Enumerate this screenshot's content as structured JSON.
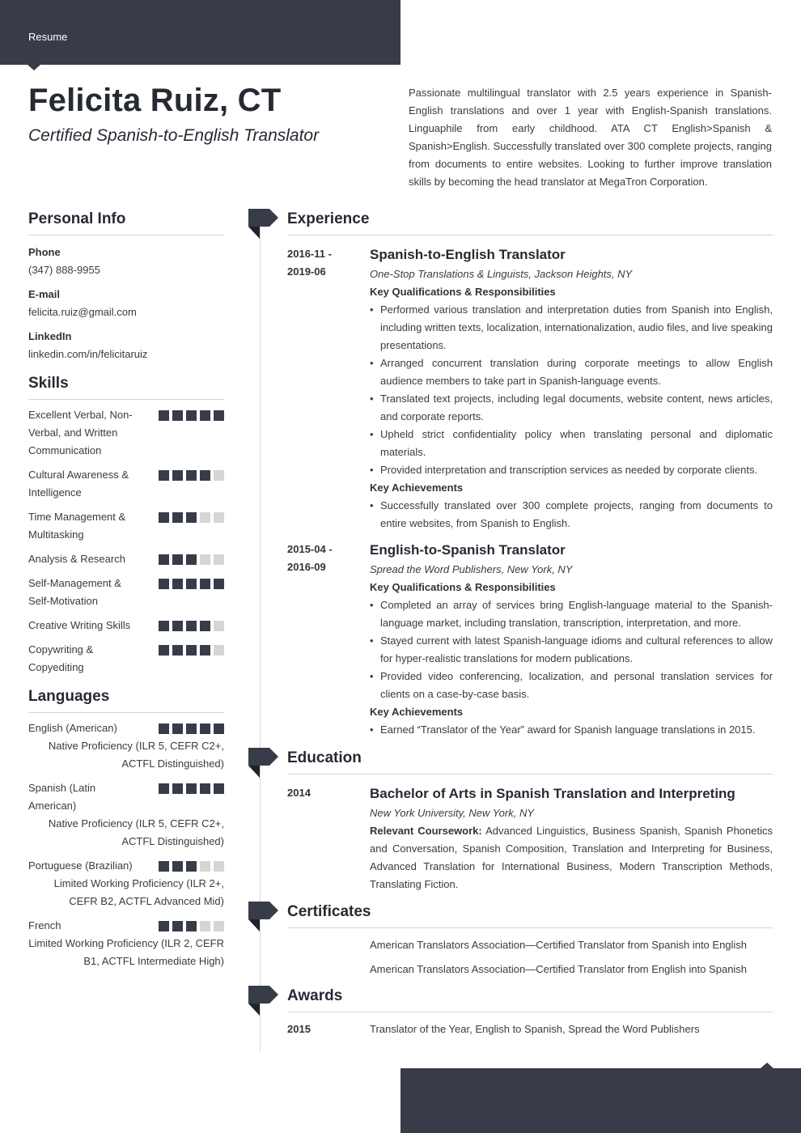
{
  "header": {
    "label": "Resume",
    "name": "Felicita Ruiz, CT",
    "title": "Certified Spanish-to-English Translator",
    "summary": "Passionate multilingual translator with 2.5 years experience in Spanish-English translations and over 1 year with English-Spanish translations. Linguaphile from early childhood. ATA CT English>Spanish & Spanish>English. Successfully translated over 300 complete projects, ranging from documents to entire websites. Looking to further improve translation skills by becoming the head translator at MegaTron Corporation."
  },
  "personal_info": {
    "heading": "Personal Info",
    "items": [
      {
        "label": "Phone",
        "value": "(347) 888-9955"
      },
      {
        "label": "E-mail",
        "value": "felicita.ruiz@gmail.com"
      },
      {
        "label": "LinkedIn",
        "value": "linkedin.com/in/felicitaruiz"
      }
    ]
  },
  "skills": {
    "heading": "Skills",
    "max_level": 5,
    "items": [
      {
        "name": "Excellent Verbal, Non-Verbal, and Written Communication",
        "level": 5
      },
      {
        "name": "Cultural Awareness & Intelligence",
        "level": 4
      },
      {
        "name": "Time Management & Multitasking",
        "level": 3
      },
      {
        "name": "Analysis & Research",
        "level": 3
      },
      {
        "name": "Self-Management & Self-Motivation",
        "level": 5
      },
      {
        "name": "Creative Writing Skills",
        "level": 4
      },
      {
        "name": "Copywriting & Copyediting",
        "level": 4
      }
    ]
  },
  "languages": {
    "heading": "Languages",
    "max_level": 5,
    "items": [
      {
        "name": "English (American)",
        "level": 5,
        "proficiency": "Native Proficiency (ILR 5, CEFR C2+, ACTFL Distinguished)"
      },
      {
        "name": "Spanish (Latin American)",
        "level": 5,
        "proficiency": "Native Proficiency (ILR 5, CEFR C2+, ACTFL Distinguished)"
      },
      {
        "name": "Portuguese (Brazilian)",
        "level": 3,
        "proficiency": "Limited Working Proficiency (ILR 2+, CEFR B2, ACTFL Advanced Mid)"
      },
      {
        "name": "French",
        "level": 3,
        "proficiency": "Limited Working Proficiency (ILR 2, CEFR B1, ACTFL Intermediate High)"
      }
    ]
  },
  "experience": {
    "heading": "Experience",
    "jobs": [
      {
        "date_start": "2016-11 -",
        "date_end": "2019-06",
        "title": "Spanish-to-English Translator",
        "company": "One-Stop Translations & Linguists, Jackson Heights, NY",
        "resp_heading": "Key Qualifications & Responsibilities",
        "responsibilities": [
          "Performed various translation and interpretation duties from Spanish into English, including written texts, localization, internationalization, audio files, and live speaking presentations.",
          "Arranged concurrent translation during corporate meetings to allow English audience members to take part in Spanish-language events.",
          "Translated text projects, including legal documents, website content, news articles, and corporate reports.",
          "Upheld strict confidentiality policy when translating personal and diplomatic materials.",
          "Provided interpretation and transcription services as needed by corporate clients."
        ],
        "ach_heading": "Key Achievements",
        "achievements": [
          "Successfully translated over 300 complete projects, ranging from documents to entire websites, from Spanish to English."
        ]
      },
      {
        "date_start": "2015-04 -",
        "date_end": "2016-09",
        "title": "English-to-Spanish Translator",
        "company": "Spread the Word Publishers, New York, NY",
        "resp_heading": "Key Qualifications & Responsibilities",
        "responsibilities": [
          "Completed an array of services bring English-language material to the Spanish-language market, including translation, transcription, interpretation, and more.",
          "Stayed current with latest Spanish-language idioms and cultural references to allow for hyper-realistic translations for modern publications.",
          "Provided video conferencing, localization, and personal translation services for clients on a case-by-case basis."
        ],
        "ach_heading": "Key Achievements",
        "achievements": [
          "Earned “Translator of the Year” award for Spanish language translations in 2015."
        ]
      }
    ]
  },
  "education": {
    "heading": "Education",
    "date": "2014",
    "degree": "Bachelor of Arts in Spanish Translation and Interpreting",
    "school": "New York University, New York, NY",
    "coursework_label": "Relevant Coursework:",
    "coursework": " Advanced Linguistics, Business Spanish, Spanish Phonetics and Conversation, Spanish Composition, Translation and Interpreting for Business, Advanced Translation for International Business, Modern Transcription Methods, Translating Fiction."
  },
  "certificates": {
    "heading": "Certificates",
    "items": [
      "American Translators Association—Certified Translator from Spanish into English",
      "American Translators Association—Certified Translator from English into Spanish"
    ]
  },
  "awards": {
    "heading": "Awards",
    "items": [
      {
        "date": "2015",
        "text": "Translator of the Year, English to Spanish, Spread the Word Publishers"
      }
    ]
  },
  "colors": {
    "accent": "#373c48",
    "accent_dark": "#1f232c",
    "dot_off": "#d5d5d5",
    "divider": "#d5d5d5"
  }
}
